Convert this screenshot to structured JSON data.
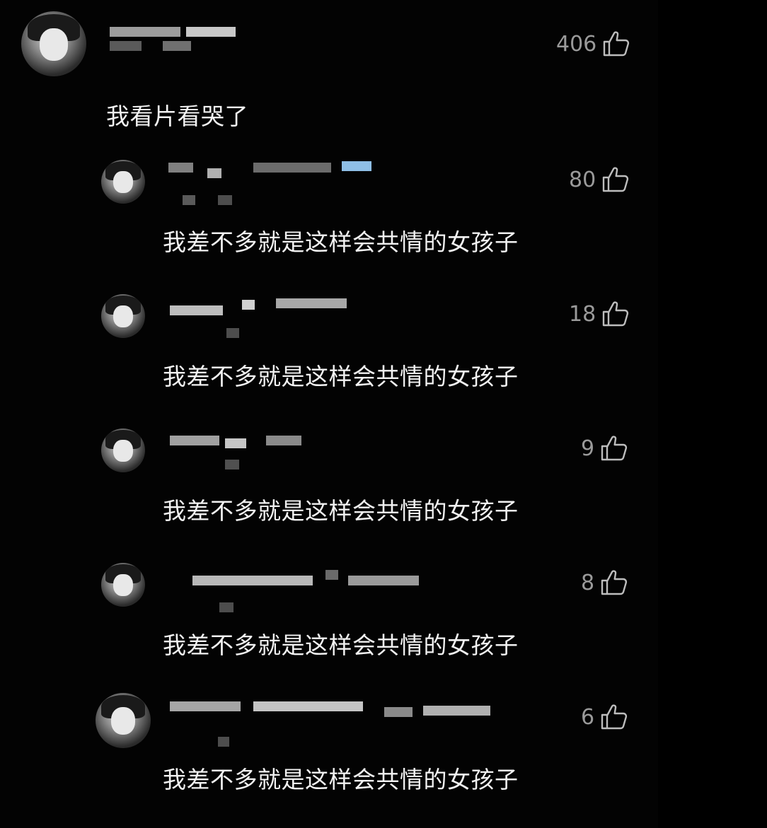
{
  "comments": [
    {
      "text": "我看片看哭了",
      "likes": "406"
    },
    {
      "text": "我差不多就是这样会共情的女孩子",
      "likes": "80"
    },
    {
      "text": "我差不多就是这样会共情的女孩子",
      "likes": "18"
    },
    {
      "text": "我差不多就是这样会共情的女孩子",
      "likes": "9"
    },
    {
      "text": "我差不多就是这样会共情的女孩子",
      "likes": "8"
    },
    {
      "text": "我差不多就是这样会共情的女孩子",
      "likes": "6"
    }
  ],
  "icons": {
    "like": "thumbs-up-icon"
  },
  "colors": {
    "background": "#000000",
    "text": "#f2f2f2",
    "muted": "#9a9a9a"
  }
}
